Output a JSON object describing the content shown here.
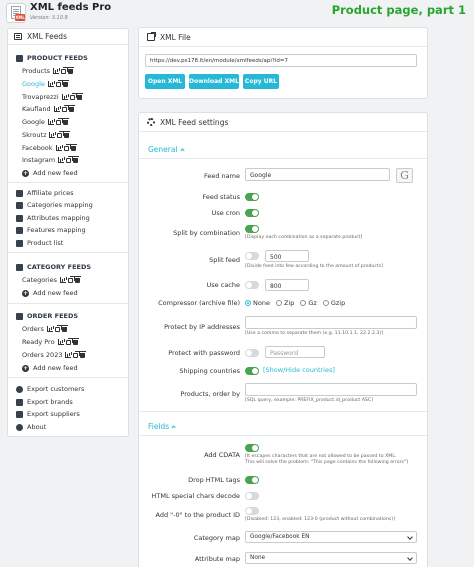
{
  "header": {
    "title": "XML feeds Pro",
    "version": "Version: 3.10.9",
    "caption": "Product page, part 1"
  },
  "sidebar": {
    "title": "XML Feeds",
    "product_section": "PRODUCT FEEDS",
    "product_feeds": [
      {
        "label": "Products",
        "active": false
      },
      {
        "label": "Google",
        "active": true
      },
      {
        "label": "Trovaprezzi",
        "active": false
      },
      {
        "label": "Kaufland",
        "active": false
      },
      {
        "label": "Google",
        "active": false
      },
      {
        "label": "Skroutz",
        "active": false
      },
      {
        "label": "Facebook",
        "active": false
      },
      {
        "label": "Instagram",
        "active": false
      }
    ],
    "add_new": "Add new feed",
    "tools": [
      "Affiliate prices",
      "Categories mapping",
      "Attributes mapping",
      "Features mapping",
      "Product list"
    ],
    "category_section": "CATEGORY FEEDS",
    "category_feeds": [
      {
        "label": "Categories"
      }
    ],
    "order_section": "ORDER FEEDS",
    "order_feeds": [
      {
        "label": "Orders"
      },
      {
        "label": "Ready Pro"
      },
      {
        "label": "Orders 2023"
      }
    ],
    "exports": [
      "Export customers",
      "Export brands",
      "Export suppliers",
      "About"
    ]
  },
  "xml_file": {
    "title": "XML File",
    "url": "https://dev.ps178.lt/en/module/xmlfeeds/api?id=7",
    "buttons": [
      "Open XML",
      "Download XML",
      "Copy URL"
    ]
  },
  "settings": {
    "title": "XML Feed settings",
    "general_label": "General",
    "feed_name_label": "Feed name",
    "feed_name_value": "Google",
    "g_badge": "G",
    "feed_status_label": "Feed status",
    "use_cron_label": "Use cron",
    "split_combo_label": "Split by combination",
    "split_combo_help": "[Display each combination as a separate product]",
    "split_feed_label": "Split feed",
    "split_feed_value": "500",
    "split_feed_help": "[Divide feed into few according to the amount of products]",
    "use_cache_label": "Use cache",
    "use_cache_value": "800",
    "compressor_label": "Compressor (archive file)",
    "compressor_options": [
      "None",
      "Zip",
      "Gz",
      "Gzip"
    ],
    "ip_label": "Protect by IP addresses",
    "ip_help": "[Use a comma to separate them (e.g. 11.10.1.1, 22.2.2.3)]",
    "password_label": "Protect with password",
    "password_placeholder": "Password",
    "shipping_label": "Shipping countries",
    "shipping_link": "[Show/Hide countries]",
    "order_by_label": "Products, order by",
    "order_by_help": "[SQL query, example: PREFIX_product.id_product ASC]",
    "fields_label": "Fields",
    "add_cdata_label": "Add CDATA",
    "add_cdata_help1": "[It escapes characters that are not allowed to be passed to XML.",
    "add_cdata_help2": "This will solve the problem: \"This page contains the following errors\"]",
    "drop_html_label": "Drop HTML tags",
    "html_special_label": "HTML special chars decode",
    "add_zero_label": "Add \"-0\" to the product ID",
    "add_zero_help": "[Disabled: 123, enabled: 123-0 (product without combinations)]",
    "category_map_label": "Category map",
    "category_map_value": "Google/Facebook EN",
    "attribute_map_label": "Attribute map",
    "attribute_map_value": "None"
  }
}
